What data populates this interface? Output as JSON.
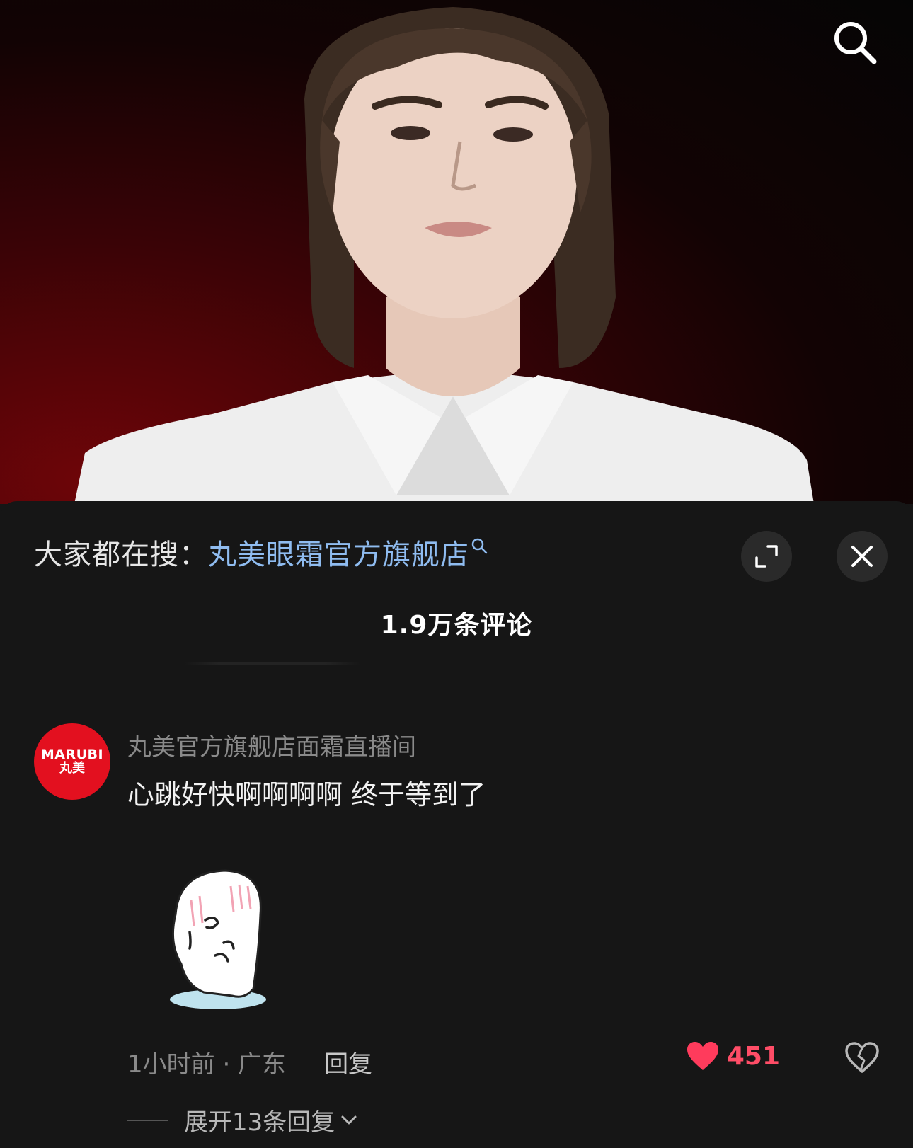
{
  "search_hint": {
    "prefix": "大家都在搜：",
    "query": "丸美眼霜官方旗舰店"
  },
  "comments_header": {
    "count_label": "1.9万条评论"
  },
  "comment": {
    "avatar_brand": "MARUBI",
    "avatar_cn": "丸美",
    "username": "丸美官方旗舰店面霜直播间",
    "text": "心跳好快啊啊啊啊 终于等到了",
    "time_location": "1小时前 · 广东",
    "reply_label": "回复",
    "like_count": "451",
    "expand_replies_label": "展开13条回复"
  },
  "colors": {
    "link": "#8fbcf0",
    "like": "#ff4d67",
    "avatar_bg": "#e3101f"
  }
}
